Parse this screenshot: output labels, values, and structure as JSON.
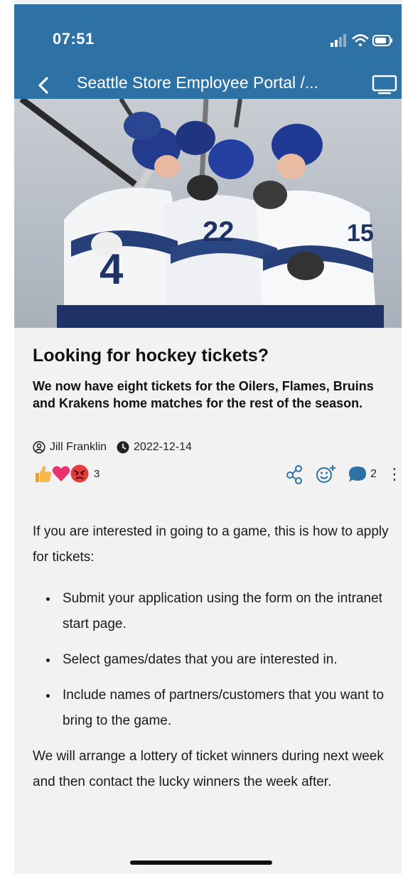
{
  "status_bar": {
    "time": "07:51"
  },
  "nav": {
    "title": "Seattle Store Employee Portal /..."
  },
  "article": {
    "title": "Looking for hockey tickets?",
    "lead": "We now have eight tickets for the Oilers, Flames, Bruins and Krakens home matches for the rest of the season.",
    "author": "Jill Franklin",
    "date": "2022-12-14",
    "reaction_count": "3",
    "comment_count": "2",
    "intro": "If you are interested in going to a game, this is how to apply for tickets:",
    "steps": [
      "Submit your application using the form on the intranet start page.",
      "Select games/dates that you are interested in.",
      "Include names of partners/customers that you want to bring to the game."
    ],
    "closing": "We will arrange a lottery of ticket winners during next week and then contact the lucky winners the week after."
  },
  "icons": {
    "back": "back-arrow-icon",
    "screen": "display-icon",
    "person": "person-icon",
    "clock": "clock-icon",
    "share": "share-icon",
    "add_reaction": "add-reaction-icon",
    "comment": "comment-icon",
    "more": "more-vertical-icon"
  },
  "colors": {
    "header": "#2e71a5",
    "comment": "#2e71a5",
    "background": "#f2f2f3"
  }
}
